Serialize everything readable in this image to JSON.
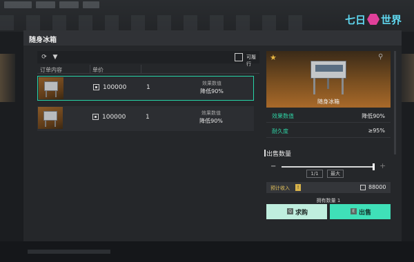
{
  "panel": {
    "title": "随身冰箱"
  },
  "logo": {
    "left": "七日",
    "right": "世界"
  },
  "toolbar": {
    "refresh_icon": "refresh-icon",
    "filter_icon": "filter-icon",
    "checkbox_label": "可履行"
  },
  "columns": {
    "content": "订单内容",
    "price": "单价"
  },
  "orders": [
    {
      "price": "100000",
      "qty": "1",
      "effect_label": "效果数值",
      "effect_value": "降低90%"
    },
    {
      "price": "100000",
      "qty": "1",
      "effect_label": "效果数值",
      "effect_value": "降低90%"
    }
  ],
  "detail": {
    "name": "随身冰箱",
    "attrs": [
      {
        "key": "效果数值",
        "value": "降低90%"
      },
      {
        "key": "耐久度",
        "value": "≥95%"
      }
    ]
  },
  "sell": {
    "section_title": "出售数量",
    "minus": "−",
    "plus": "+",
    "page_label": "1/1",
    "max_label": "最大",
    "income_label": "预计收入",
    "income_tag": "!",
    "income_value": "88000",
    "owned": "拥有数量 1",
    "buy_key": "Q",
    "buy_label": "求购",
    "sell_key": "E",
    "sell_label": "出售"
  },
  "colors": {
    "accent": "#27d6a9",
    "star": "#e7b743",
    "income": "#e3c15a"
  }
}
